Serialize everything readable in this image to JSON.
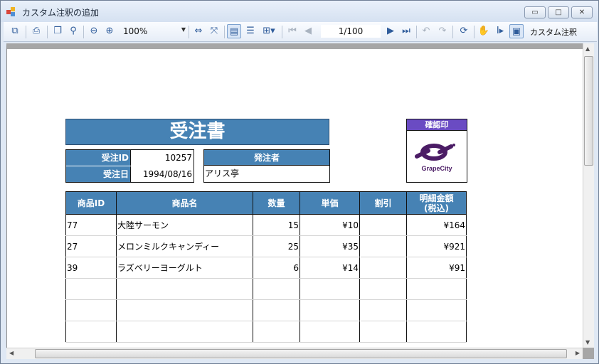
{
  "window": {
    "title": "カスタム注釈の追加",
    "buttons": {
      "minimize": "▭",
      "maximize": "□",
      "close": "✕"
    }
  },
  "toolbar": {
    "zoom": "100%",
    "page": "1/100",
    "custom_annotation": "カスタム注釈"
  },
  "report": {
    "title": "受注書",
    "order_id_label": "受注ID",
    "order_id": "10257",
    "order_date_label": "受注日",
    "order_date": "1994/08/16",
    "orderer_label": "発注者",
    "orderer_name": "アリス亭",
    "stamp_label": "確認印",
    "stamp_logo_text": "GrapeCity",
    "columns": [
      "商品ID",
      "商品名",
      "数量",
      "単価",
      "割引",
      "明細金額\n(税込)"
    ],
    "rows": [
      [
        "77",
        "大陸サーモン",
        "15",
        "¥10",
        "",
        "¥164"
      ],
      [
        "27",
        "メロンミルクキャンディー",
        "25",
        "¥35",
        "",
        "¥921"
      ],
      [
        "39",
        "ラズベリーヨーグルト",
        "6",
        "¥14",
        "",
        "¥91"
      ],
      [
        "",
        "",
        "",
        "",
        "",
        ""
      ],
      [
        "",
        "",
        "",
        "",
        "",
        ""
      ],
      [
        "",
        "",
        "",
        "",
        "",
        ""
      ]
    ]
  }
}
